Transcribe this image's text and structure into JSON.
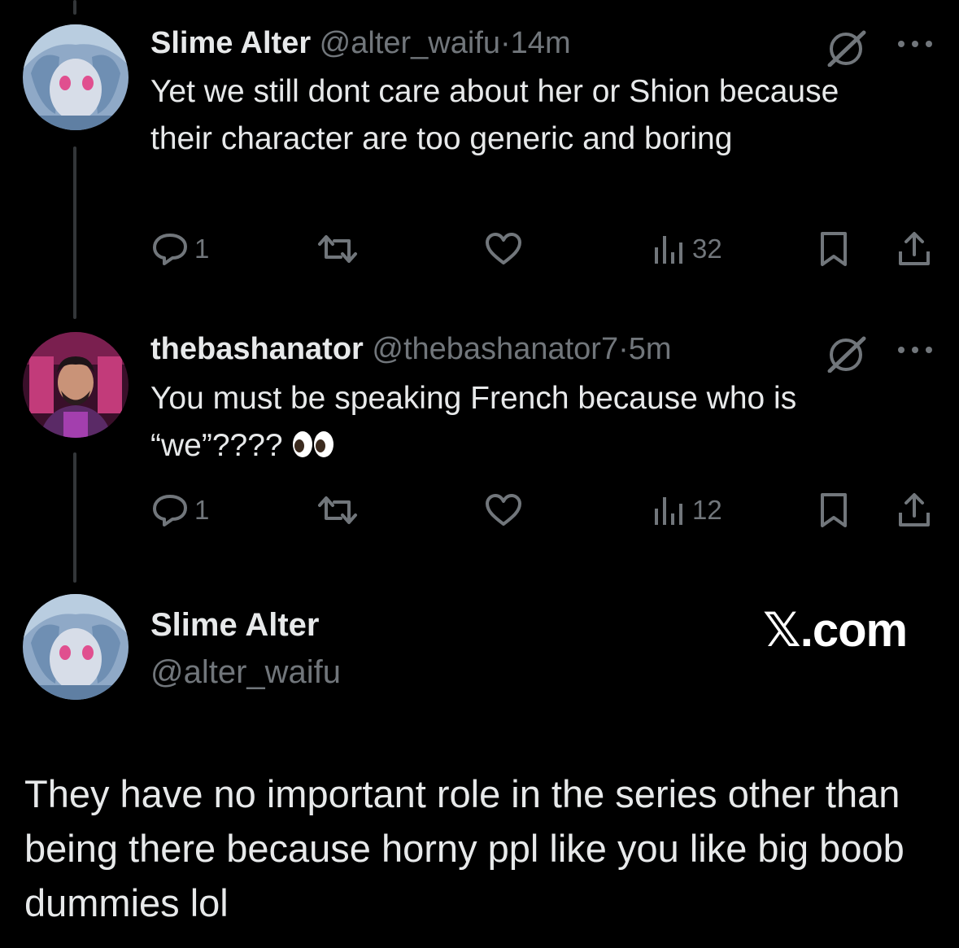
{
  "thread": [
    {
      "name": "Slime Alter",
      "handle": "@alter_waifu",
      "separator": "·",
      "time": "14m",
      "text": "Yet we still dont care about her or Shion because their character are too generic and boring",
      "replies": "1",
      "views": "32"
    },
    {
      "name": "thebashanator",
      "handle": "@thebashanator7",
      "separator": "·",
      "time": "5m",
      "text": "You must be speaking French because who is “we”????",
      "emoji": "eyes-emoji",
      "replies": "1",
      "views": "12"
    }
  ],
  "main_post": {
    "name": "Slime Alter",
    "handle": "@alter_waifu",
    "text": "They have no important role in the series other than being there because horny ppl like you like big boob dummies lol"
  },
  "brand": "𝕏.com",
  "icons": [
    "grok-icon",
    "more-icon",
    "reply-icon",
    "repost-icon",
    "like-icon",
    "views-icon",
    "bookmark-icon",
    "share-icon"
  ],
  "colors": {
    "background": "#000000",
    "text": "#e7e9ea",
    "secondary": "#71767b",
    "thread_line": "#333639"
  }
}
